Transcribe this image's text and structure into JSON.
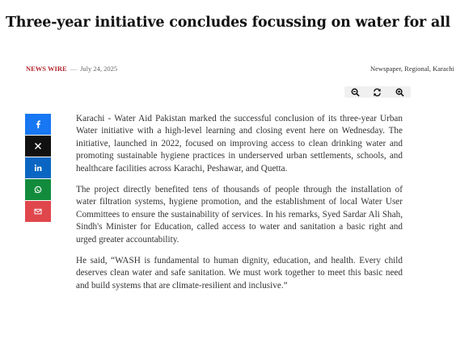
{
  "article": {
    "title": "Three-year initiative concludes focussing on water for all",
    "source": "NEWS WIRE",
    "separator": "—",
    "date": "July 24, 2025",
    "tags": "Newspaper, Regional, Karachi",
    "paragraphs": [
      "Karachi - Water Aid Pakistan marked the successful conclusion of its three-year Urban Water initiative with a high-level learning and closing event here on Wednesday. The initiative, launched in 2022, focused on improving access to clean drinking water and promoting sustainable hygiene practices in underserved urban settlements, schools, and healthcare facilities across Karachi, Peshawar, and Quetta.",
      "The project directly benefited tens of thousands of people through the installation of water filtration systems, hygiene promotion, and the establishment of local Water User Committees to ensure the sustainability of services. In his remarks, Syed Sardar Ali Shah, Sindh's Minister for Education, called access to water and sanitation a basic right and urged greater accountability.",
      "He said, “WASH is fundamental to human dignity, education, and health. Every child deserves clean water and safe sanitation. We must work together to meet this basic need and build systems that are climate-resilient and inclusive.”"
    ]
  },
  "font_tools": [
    {
      "icon": "zoom-out-icon"
    },
    {
      "icon": "reset-icon"
    },
    {
      "icon": "zoom-in-icon"
    }
  ],
  "share": [
    {
      "icon": "facebook-icon",
      "color": "#1877f2"
    },
    {
      "icon": "x-icon",
      "color": "#111111"
    },
    {
      "icon": "linkedin-icon",
      "color": "#0a66c2"
    },
    {
      "icon": "whatsapp-icon",
      "color": "#128c3c"
    },
    {
      "icon": "email-icon",
      "color": "#e0474c"
    }
  ]
}
